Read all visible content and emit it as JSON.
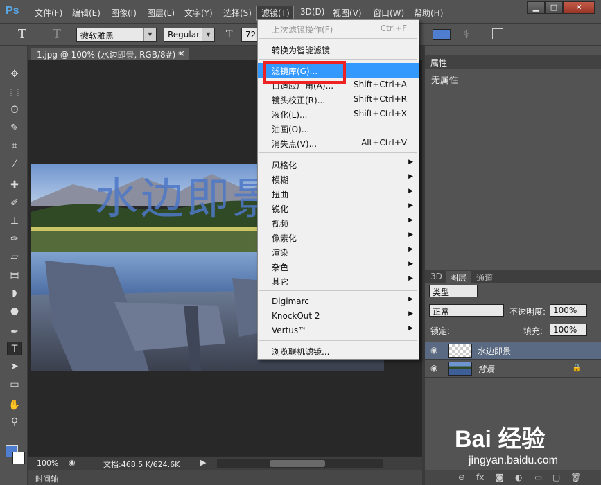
{
  "app": {
    "logo": "Ps"
  },
  "menubar": {
    "items": [
      "文件(F)",
      "编辑(E)",
      "图像(I)",
      "图层(L)",
      "文字(Y)",
      "选择(S)",
      "滤镜(T)",
      "3D(D)",
      "视图(V)",
      "窗口(W)",
      "帮助(H)"
    ],
    "window_controls": [
      "▁",
      "□",
      "✕"
    ]
  },
  "options": {
    "tool_glyph": "T",
    "font": "微软雅黑",
    "style": "Regular",
    "size": "72",
    "text_color": "#4f7ed0"
  },
  "document": {
    "tab_title": "1.jpg @ 100% (水边即景, RGB/8#) *",
    "close_glyph": "×",
    "overlay_text": "水边即景",
    "zoom": "100%",
    "doc_info": "文档:468.5 K/624.6K",
    "timeline_label": "时间轴"
  },
  "filter_menu": {
    "items": [
      {
        "label": "上次滤镜操作(F)",
        "shortcut": "Ctrl+F",
        "disabled": true
      },
      {
        "label": "转换为智能滤镜",
        "shortcut": ""
      },
      {
        "label": "滤镜库(G)...",
        "shortcut": "",
        "highlighted": true
      },
      {
        "label": "自适应广角(A)...",
        "shortcut": "Shift+Ctrl+A"
      },
      {
        "label": "镜头校正(R)...",
        "shortcut": "Shift+Ctrl+R"
      },
      {
        "label": "液化(L)...",
        "shortcut": "Shift+Ctrl+X"
      },
      {
        "label": "油画(O)...",
        "shortcut": ""
      },
      {
        "label": "消失点(V)...",
        "shortcut": "Alt+Ctrl+V"
      },
      {
        "label": "风格化",
        "submenu": true
      },
      {
        "label": "模糊",
        "submenu": true
      },
      {
        "label": "扭曲",
        "submenu": true
      },
      {
        "label": "锐化",
        "submenu": true
      },
      {
        "label": "视频",
        "submenu": true
      },
      {
        "label": "像素化",
        "submenu": true
      },
      {
        "label": "渲染",
        "submenu": true
      },
      {
        "label": "杂色",
        "submenu": true
      },
      {
        "label": "其它",
        "submenu": true
      },
      {
        "label": "Digimarc",
        "submenu": true
      },
      {
        "label": "KnockOut 2",
        "submenu": true
      },
      {
        "label": "Vertus™",
        "submenu": true
      },
      {
        "label": "浏览联机滤镜...",
        "shortcut": ""
      }
    ]
  },
  "properties": {
    "title": "属性",
    "body": "无属性"
  },
  "layers": {
    "tabs": [
      "3D",
      "图层",
      "通道"
    ],
    "filter_kind": "类型",
    "blend_mode": "正常",
    "opacity_label": "不透明度:",
    "opacity": "100%",
    "lock_label": "锁定:",
    "fill_label": "填充:",
    "fill": "100%",
    "rows": [
      {
        "name": "水边即景",
        "selected": true
      },
      {
        "name": "背景",
        "selected": false
      }
    ]
  },
  "watermark": {
    "logo": "Bai 经验",
    "url": "jingyan.baidu.com"
  },
  "accent_color": "#3399ff",
  "highlight_color": "#e22222"
}
